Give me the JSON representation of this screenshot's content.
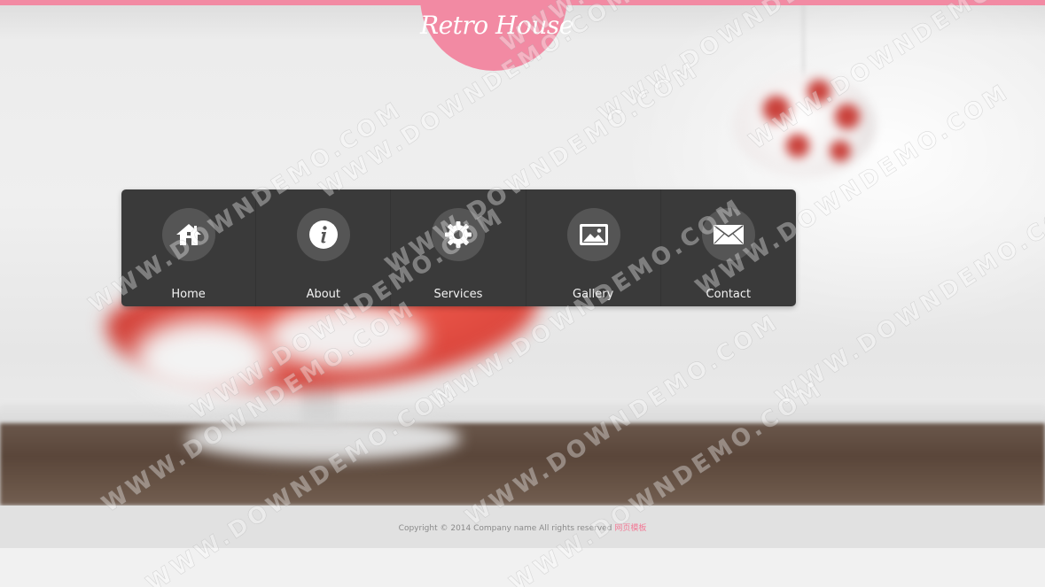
{
  "brand": {
    "logo_text": "Retro House",
    "accent_color": "#f28aa3"
  },
  "nav": {
    "items": [
      {
        "label": "Home",
        "icon": "home-icon"
      },
      {
        "label": "About",
        "icon": "info-icon"
      },
      {
        "label": "Services",
        "icon": "gear-icon"
      },
      {
        "label": "Gallery",
        "icon": "image-icon"
      },
      {
        "label": "Contact",
        "icon": "mail-icon"
      }
    ]
  },
  "footer": {
    "copyright": "Copyright © 2014 Company name All rights reserved ",
    "link_text": "网页模板",
    "link_color": "#f27a96"
  },
  "watermark": {
    "text": "WWW.DOWNDEMO.COM"
  }
}
